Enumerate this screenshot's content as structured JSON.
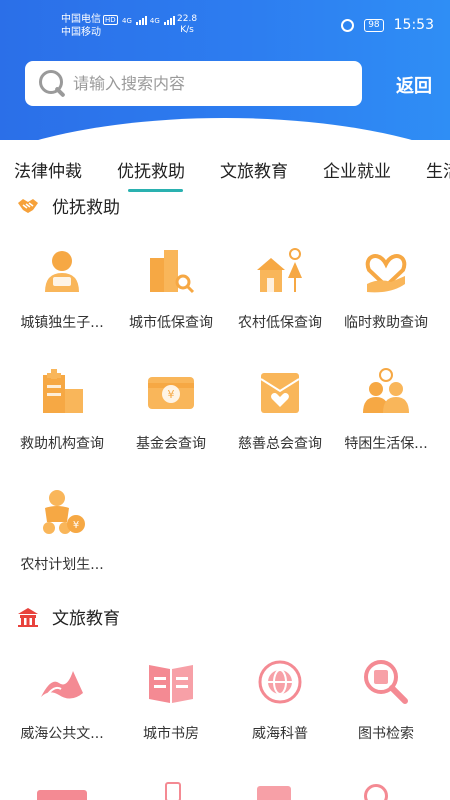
{
  "status_bar": {
    "carrier_1": "中国电信",
    "hd": "HD",
    "carrier_2": "中国移动",
    "net_1": "4G",
    "net_2": "4G",
    "speed_value": "22.8",
    "speed_unit": "K/s",
    "battery": "98",
    "time": "15:53"
  },
  "header": {
    "search_placeholder": "请输入搜索内容",
    "back_label": "返回",
    "gradient_start": "#2b6fe8",
    "gradient_end": "#2f8ef5"
  },
  "tabs": [
    {
      "label": "法律仲裁"
    },
    {
      "label": "优抚救助",
      "active": true
    },
    {
      "label": "文旅教育"
    },
    {
      "label": "企业就业"
    },
    {
      "label": "生活"
    }
  ],
  "accent_color": "#2ab1b0",
  "sections": [
    {
      "title": "优抚救助",
      "icon": "handshake-icon",
      "items": [
        {
          "label": "城镇独生子...",
          "icon": "subsidy-person-icon"
        },
        {
          "label": "城市低保查询",
          "icon": "city-building-search-icon"
        },
        {
          "label": "农村低保查询",
          "icon": "village-house-search-icon"
        },
        {
          "label": "临时救助查询",
          "icon": "heart-hand-icon"
        },
        {
          "label": "救助机构查询",
          "icon": "hospital-building-icon"
        },
        {
          "label": "基金会查询",
          "icon": "yuan-card-icon"
        },
        {
          "label": "慈善总会查询",
          "icon": "charity-heart-envelope-icon"
        },
        {
          "label": "特困生活保...",
          "icon": "people-group-icon"
        },
        {
          "label": "农村计划生...",
          "icon": "baby-yuan-icon"
        }
      ]
    },
    {
      "title": "文旅教育",
      "icon": "temple-icon",
      "items": [
        {
          "label": "威海公共文...",
          "icon": "culture-scroll-icon"
        },
        {
          "label": "城市书房",
          "icon": "open-book-icon"
        },
        {
          "label": "威海科普",
          "icon": "science-globe-icon"
        },
        {
          "label": "图书检索",
          "icon": "book-search-icon"
        }
      ]
    }
  ]
}
